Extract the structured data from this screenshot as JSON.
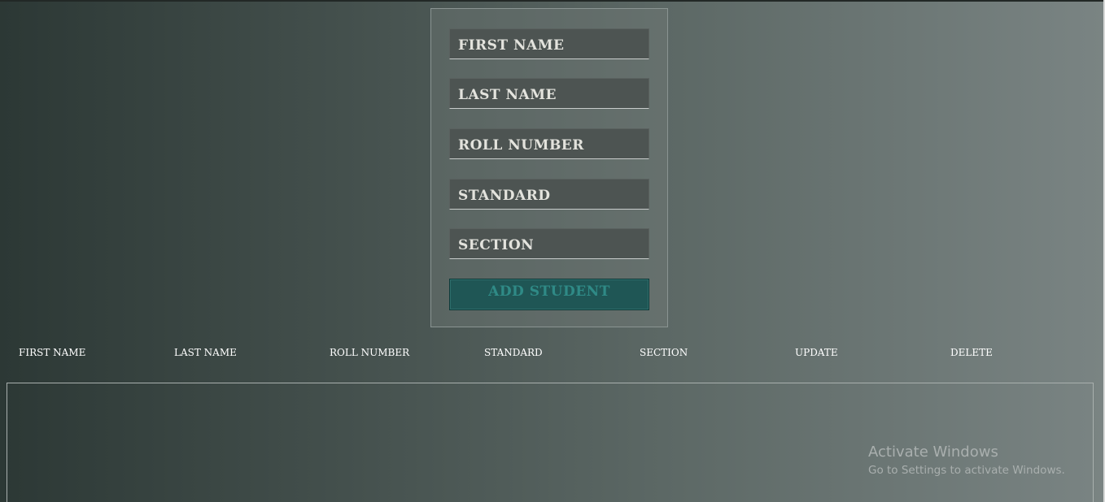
{
  "form": {
    "fields": [
      {
        "placeholder": "FIRST NAME",
        "value": ""
      },
      {
        "placeholder": "LAST NAME",
        "value": ""
      },
      {
        "placeholder": "ROLL NUMBER",
        "value": ""
      },
      {
        "placeholder": "STANDARD",
        "value": ""
      },
      {
        "placeholder": "SECTION",
        "value": ""
      }
    ],
    "submit_label": "ADD STUDENT"
  },
  "table": {
    "columns": [
      "FIRST NAME",
      "LAST NAME",
      "ROLL NUMBER",
      "STANDARD",
      "SECTION",
      "UPDATE",
      "DELETE"
    ],
    "rows": []
  },
  "watermark": {
    "title": "Activate Windows",
    "subtitle": "Go to Settings to activate Windows."
  },
  "colors": {
    "button_bg": "#1f5655",
    "button_text": "#2f8a86",
    "field_bg": "#4d5452"
  }
}
